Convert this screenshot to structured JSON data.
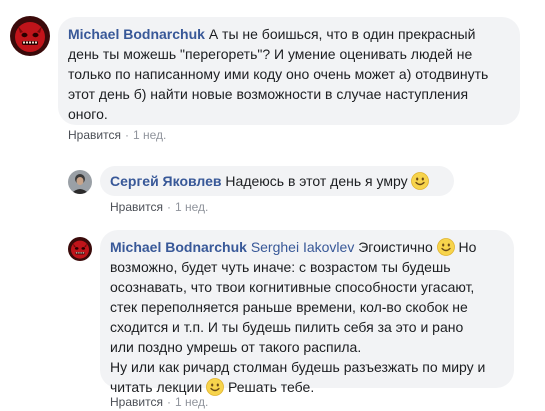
{
  "comments": [
    {
      "author": "Michael Bodnarchuk",
      "lines": [
        "А ты не боишься, что в один прекрасный",
        "день ты можешь \"перегореть\"? И умение оценивать людей не",
        "только по написанному ими коду оно очень может а) отодвинуть",
        "этот день б) найти новые возможности в случае наступления",
        "оного."
      ],
      "like_label": "Нравится",
      "separator": "·",
      "time": "1 нед."
    },
    {
      "author": "Сергей Яковлев",
      "text": "Надеюсь в этот день я умру",
      "like_label": "Нравится",
      "separator": "·",
      "time": "1 нед."
    },
    {
      "author": "Michael Bodnarchuk",
      "mention": "Serghei Iakovlev",
      "first_text": "Эгоистично",
      "first_text_after": "Но",
      "lines": [
        "возможно, будет чуть иначе: с возрастом ты будешь",
        "осознавать, что твои когнитивные способности угасают,",
        "стек переполняется раньше времени, кол-во скобок не",
        "сходится и т.п. И ты будешь пилить себя за это и рано",
        "или поздно умрешь от такого распила.",
        "Ну или как ричард столман будешь разъезжать по миру и"
      ],
      "last_line_before": "читать лекции",
      "last_line_after": "Решать тебе.",
      "like_label": "Нравится",
      "separator": "·",
      "time": "1 нед."
    }
  ],
  "icons": {
    "avatar_1": "red-devil-avatar",
    "avatar_2": "man-portrait-avatar",
    "smiley": "smiley-emoji-icon"
  },
  "colors": {
    "bubble": "#f2f3f5",
    "author": "#385898",
    "meta": "#90949c",
    "smiley_fill": "#f7d44c"
  }
}
